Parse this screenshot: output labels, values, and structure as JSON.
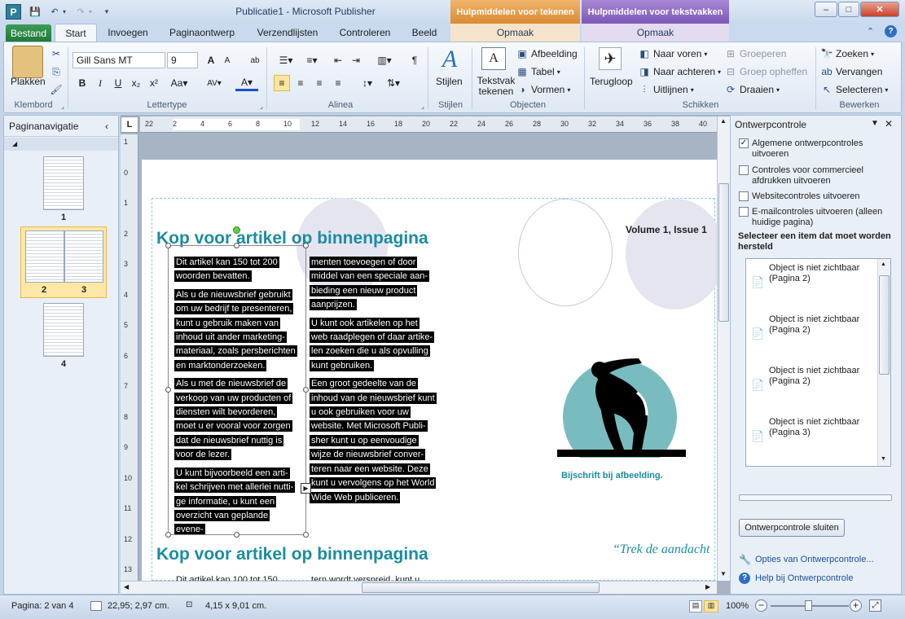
{
  "window": {
    "title": "Publicatie1  -  Microsoft Publisher",
    "ctx_draw": "Hulpmiddelen voor tekenen",
    "ctx_text": "Hulpmiddelen voor tekstvakken",
    "ctx_sub": "Opmaak",
    "min": "–",
    "max": "□",
    "close": "✕"
  },
  "tabs": [
    "Bestand",
    "Start",
    "Invoegen",
    "Paginaontwerp",
    "Verzendlijsten",
    "Controleren",
    "Beeld"
  ],
  "ribbon": {
    "clipboard": {
      "paste": "Plakken",
      "label": "Klembord"
    },
    "font": {
      "name": "Gill Sans MT",
      "size": "9",
      "label": "Lettertype"
    },
    "paragraph": {
      "label": "Alinea"
    },
    "styles": {
      "btn": "Stijlen",
      "label": "Stijlen"
    },
    "objects": {
      "textbox": "Tekstvak tekenen",
      "picture": "Afbeelding",
      "table": "Tabel",
      "shapes": "Vormen",
      "label": "Objecten"
    },
    "arrange": {
      "wrap": "Terugloop",
      "forward": "Naar voren",
      "backward": "Naar achteren",
      "align": "Uitlijnen",
      "group": "Groeperen",
      "ungroup": "Groep opheffen",
      "rotate": "Draaien",
      "label": "Schikken"
    },
    "edit": {
      "find": "Zoeken",
      "replace": "Vervangen",
      "select": "Selecteren",
      "label": "Bewerken"
    }
  },
  "pagenav": {
    "title": "Paginanavigatie",
    "pages": [
      "1",
      "2",
      "3",
      "4"
    ]
  },
  "document": {
    "heading1": "Kop voor artikel op binnenpagina",
    "heading2": "Kop voor artikel op binnenpagina",
    "volume": "Volume 1, Issue 1",
    "caption": "Bijschrift bij afbeelding.",
    "quote": "“Trek de aandacht",
    "col1": [
      "Dit artikel kan 150 tot 200 woorden bevatten.",
      "Als u de nieuwsbrief gebruikt om uw bedrijf te presenteren, kunt u gebruik maken van inhoud uit ander marketing-materiaal, zoals persberichten en marktonderzoeken.",
      "Als u met de nieuwsbrief de verkoop van uw producten of diensten wilt bevorderen, moet u er vooral voor zorgen dat de nieuwsbrief nuttig is voor de lezer.",
      "U kunt bijvoorbeeld een arti-kel schrijven met allerlei nutti-ge informatie, u kunt een overzicht van geplande evene-"
    ],
    "col2": [
      "menten toevoegen of door middel van een speciale aan-bieding een nieuw product aanprijzen.",
      "U kunt ook artikelen op het web raadplegen of daar artike-len zoeken die u als opvulling kunt gebruiken.",
      "Een groot gedeelte van de inhoud van de nieuwsbrief kunt u ook gebruiken voor uw website. Met Microsoft Publi-sher kunt u op eenvoudige wijze de nieuwsbrief conver-teren naar een website. Deze kunt u vervolgens op het World Wide Web publiceren."
    ],
    "bottom1": "Dit artikel kan 100 tot 150",
    "bottom2": "tern wordt verspreid, kunt u",
    "ruler_h": [
      "22",
      "2",
      "4",
      "6",
      "8",
      "10",
      "12",
      "14",
      "16",
      "18",
      "20",
      "22",
      "24",
      "26",
      "28",
      "30",
      "32",
      "34",
      "36",
      "38",
      "40"
    ],
    "ruler_v": [
      "1",
      "0",
      "1",
      "2",
      "3",
      "4",
      "5",
      "6",
      "7",
      "8",
      "9",
      "10",
      "11",
      "12",
      "13"
    ]
  },
  "checker": {
    "title": "Ontwerpcontrole",
    "options": [
      {
        "label": "Algemene ontwerpcontroles uitvoeren",
        "checked": true
      },
      {
        "label": "Controles voor commercieel afdrukken uitvoeren",
        "checked": false
      },
      {
        "label": "Websitecontroles uitvoeren",
        "checked": false
      },
      {
        "label": "E-mailcontroles uitvoeren (alleen huidige pagina)",
        "checked": false
      }
    ],
    "select_label": "Selecteer een item dat moet worden hersteld",
    "items": [
      "Object is niet zichtbaar (Pagina 2)",
      "Object is niet zichtbaar (Pagina 2)",
      "Object is niet zichtbaar (Pagina 2)",
      "Object is niet zichtbaar (Pagina 3)"
    ],
    "close_btn": "Ontwerpcontrole sluiten",
    "options_link": "Opties van Ontwerpcontrole...",
    "help_link": "Help bij Ontwerpcontrole"
  },
  "status": {
    "page": "Pagina: 2 van 4",
    "position": "22,95; 2,97 cm.",
    "size": "4,15 x  9,01 cm.",
    "zoom": "100%"
  }
}
